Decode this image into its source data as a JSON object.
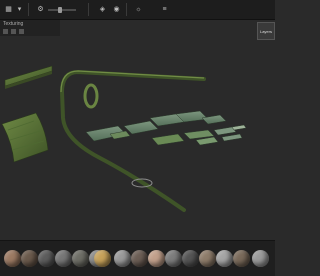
{
  "toolbar": {
    "icons": [
      "grid-icon",
      "dropdown-icon",
      "settings-icon",
      "cube-icon",
      "camera-icon",
      "sun-icon",
      "layers-icon"
    ]
  },
  "subbar": {
    "label": "Texturing"
  },
  "side_tab": {
    "label": "Layers"
  },
  "colors": {
    "background": "#2a2a2a",
    "moss": "#5f7a3a",
    "moss_dark": "#3e5326",
    "panel": "#1d1d1d"
  },
  "material_shelf": {
    "materials": [
      {
        "name": "mat-01",
        "color": "#9c7a63"
      },
      {
        "name": "mat-02",
        "color": "#6b5a4c"
      },
      {
        "name": "mat-03",
        "color": "#5d5d5d"
      },
      {
        "name": "mat-04",
        "color": "#777777"
      },
      {
        "name": "mat-05",
        "color": "#6e6e66"
      },
      {
        "name": "mat-06",
        "color": "#8a8a8a"
      },
      {
        "name": "mat-07",
        "color": "#c7a25a"
      },
      {
        "name": "mat-08",
        "color": "#9a9a9a"
      },
      {
        "name": "mat-09",
        "color": "#6c5e55"
      },
      {
        "name": "mat-10",
        "color": "#c2a08b"
      },
      {
        "name": "mat-11",
        "color": "#7d7d7d"
      },
      {
        "name": "mat-12",
        "color": "#555555"
      },
      {
        "name": "mat-13",
        "color": "#8e7c6a"
      },
      {
        "name": "mat-14",
        "color": "#a5a5a5"
      },
      {
        "name": "mat-15",
        "color": "#7a6a5a"
      },
      {
        "name": "mat-16",
        "color": "#9b9b9b"
      }
    ]
  }
}
